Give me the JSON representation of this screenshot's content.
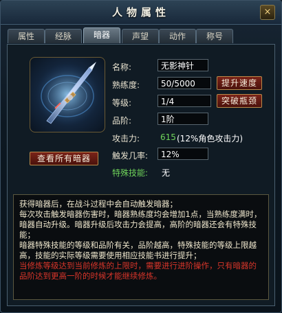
{
  "window": {
    "title": "人物属性",
    "close_label": "×"
  },
  "tabs": [
    {
      "label": "属性",
      "active": false
    },
    {
      "label": "经脉",
      "active": false
    },
    {
      "label": "暗器",
      "active": true
    },
    {
      "label": "声望",
      "active": false
    },
    {
      "label": "动作",
      "active": false
    },
    {
      "label": "称号",
      "active": false
    }
  ],
  "weapon": {
    "name_label": "名称:",
    "name_value": "无影神针",
    "proficiency_label": "熟练度:",
    "proficiency_value": "50/5000",
    "level_label": "等级:",
    "level_value": "1/4",
    "grade_label": "品阶:",
    "grade_value": "1阶",
    "attack_label": "攻击力:",
    "attack_value": "615",
    "attack_note": "(12%角色攻击力)",
    "trigger_label": "触发几率:",
    "trigger_value": "12%",
    "skill_label": "特殊技能:",
    "skill_value": "无"
  },
  "buttons": {
    "speed_up": "提升速度",
    "breakthrough": "突破瓶颈",
    "view_all": "查看所有暗器"
  },
  "description": {
    "line1": "获得暗器后，在战斗过程中会自动触发暗器；",
    "line2": "每次攻击触发暗器伤害时，暗器熟练度均会增加1点，当熟练度满时，暗器自动升级。暗器升级后攻击力会提高，高阶的暗器还会有特殊技能；",
    "line3": "暗器特殊技能的等级和品阶有关，品阶越高，特殊技能的等级上限越高，技能的实际等级需要使用相应技能书进行提升；",
    "line4": "当修炼等级达到当前修炼的上限时，需要进行进阶操作，只有暗器的品阶达到更高一阶的时候才能继续修炼。"
  },
  "colors": {
    "accent_green": "#6fd35a",
    "warning_red": "#d8352a",
    "button_red": "#7a2418"
  },
  "icons": {
    "weapon": "hidden-needle-weapon-icon",
    "close": "close-icon"
  }
}
